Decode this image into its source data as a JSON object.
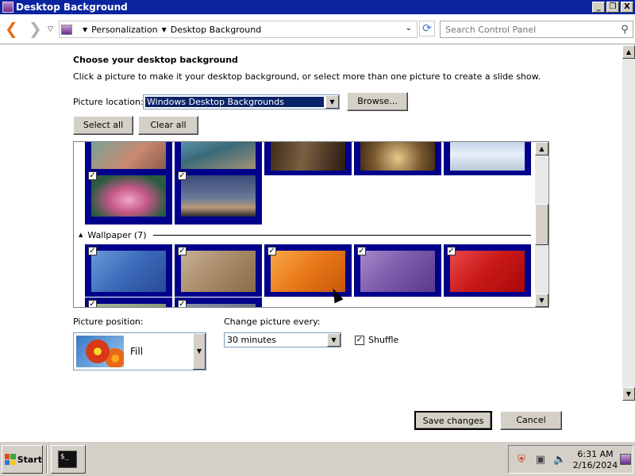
{
  "window": {
    "title": "Desktop Background"
  },
  "titlebar": {
    "minimize": "_",
    "maximize": "❐",
    "close": "X"
  },
  "address": {
    "crumbs": [
      "Personalization",
      "Desktop Background"
    ],
    "search_placeholder": "Search Control Panel"
  },
  "main": {
    "heading": "Choose your desktop background",
    "description": "Click a picture to make it your desktop background, or select more than one picture to create a slide show.",
    "picture_location_label": "Picture location:",
    "picture_location_value": "Windows Desktop Backgrounds",
    "browse_label": "Browse...",
    "select_all_label": "Select all",
    "clear_all_label": "Clear all",
    "group_wallpaper_label": "Wallpaper (7)",
    "checkmark": "✓",
    "picture_position_label": "Picture position:",
    "picture_position_value": "Fill",
    "change_picture_label": "Change picture every:",
    "change_picture_value": "30 minutes",
    "shuffle_label": "Shuffle",
    "save_label": "Save changes",
    "cancel_label": "Cancel"
  },
  "colors": {
    "titlebar": "#0b24a0",
    "selection": "#00008b",
    "chrome": "#d4d0c8"
  },
  "taskbar": {
    "start_label": "Start",
    "terminal_icon": "$_",
    "time": "6:31 AM",
    "date": "2/16/2024"
  }
}
